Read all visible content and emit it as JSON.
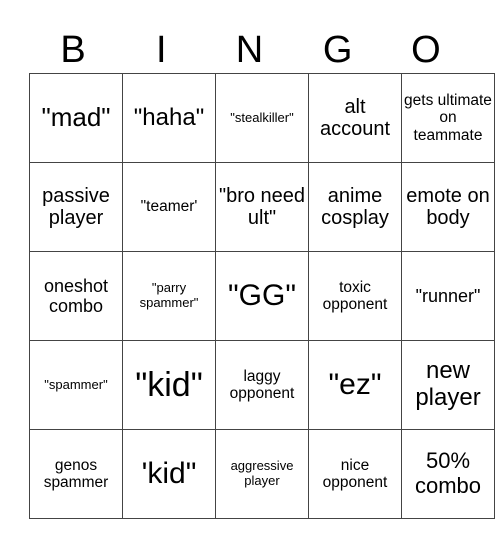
{
  "header": [
    "B",
    "I",
    "N",
    "G",
    "O"
  ],
  "rows": [
    [
      "\"mad\"",
      "\"haha\"",
      "\"stealkiller\"",
      "alt account",
      "gets ultimate on teammate"
    ],
    [
      "passive player",
      "\"teamer'",
      "\"bro need ult\"",
      "anime cosplay",
      "emote on body"
    ],
    [
      "oneshot combo",
      "\"parry spammer\"",
      "\"GG\"",
      "toxic opponent",
      "\"runner\""
    ],
    [
      "\"spammer\"",
      "\"kid\"",
      "laggy opponent",
      "\"ez\"",
      "new player"
    ],
    [
      "genos spammer",
      "'kid\"",
      "aggressive player",
      "nice opponent",
      "50% combo"
    ]
  ]
}
